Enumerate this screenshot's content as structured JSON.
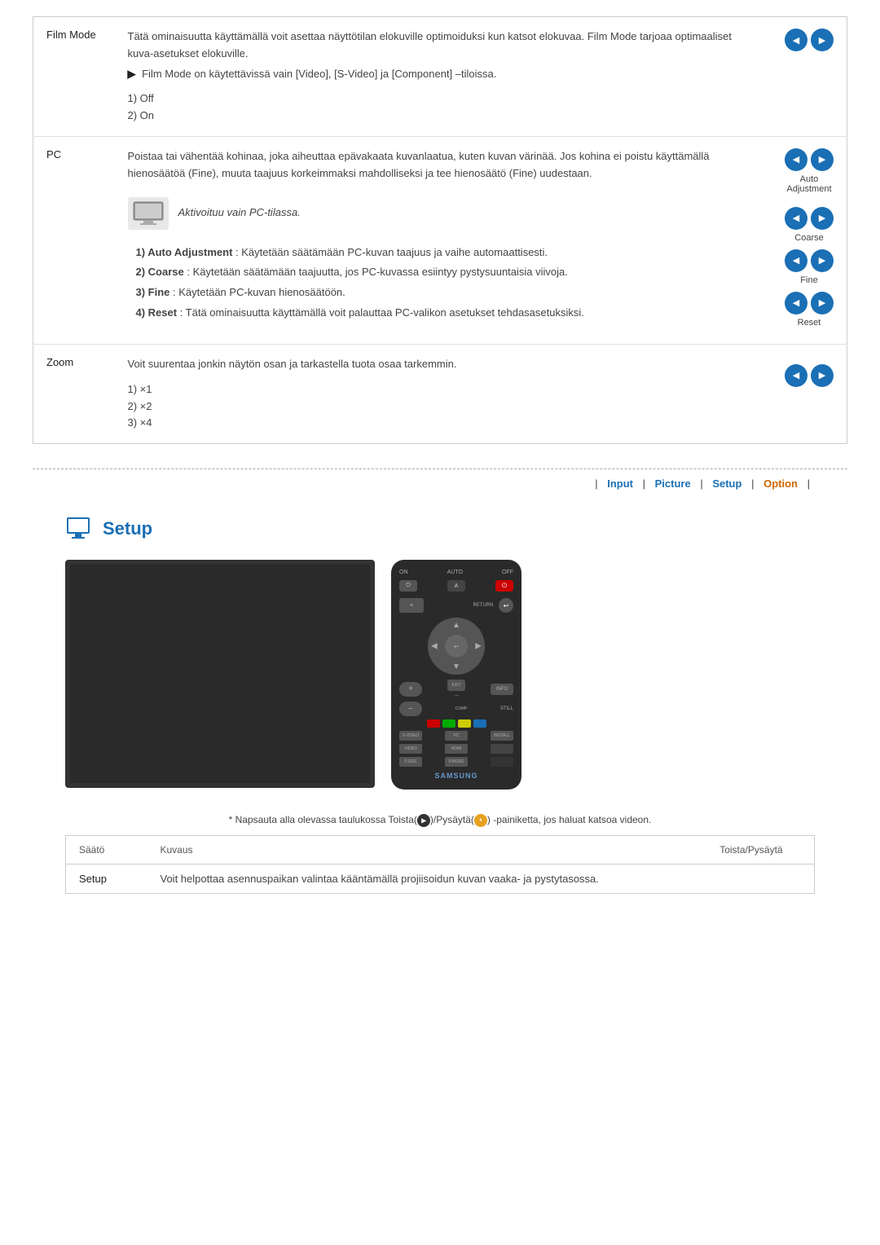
{
  "topSection": {
    "rows": [
      {
        "label": "Film Mode",
        "content_lines": [
          "Tätä ominaisuutta käyttämällä voit asettaa näyttötilan elokuville optimoiduksi kun katsot",
          "elokuvaa. Film Mode tarjoaa optimaaliset kuva-asetukset elokuville.",
          "▶ Film Mode on käytettävissä vain [Video], [S-Video] ja [Component] –tiloissa."
        ],
        "options": [
          "1) Off",
          "2) On"
        ],
        "hasButtons": true,
        "buttonPairs": 1
      },
      {
        "label": "PC",
        "content_lines": [
          "Poistaa tai vähentää kohinaa, joka aiheuttaa epävakaata kuvanlaatua, kuten kuvan",
          "värinää. Jos kohina ei poistu käyttämällä hienosäätöä (Fine), muuta taajuus",
          "korkeimmaksi mahdolliseksi ja tee hienosäätö (Fine) uudestaan."
        ],
        "pc_note": "Aktivoituu vain PC-tilassa.",
        "numbered_items": [
          {
            "prefix": "1) Auto Adjustment",
            "rest": ": Käytetään säätämään PC-kuvan taajuus ja vaihe automaattisesti."
          },
          {
            "prefix": "2) Coarse",
            "rest": ": Käytetään säätämään taajuutta, jos PC-kuvassa esiintyy pystysuuntaisia viivoja."
          },
          {
            "prefix": "3) Fine",
            "rest": ": Käytetään PC-kuvan hienosäätöön."
          },
          {
            "prefix": "4) Reset",
            "rest": ": Tätä ominaisuutta käyttämällä voit palauttaa PC-valikon asetukset tehdasasetuksiksi."
          }
        ],
        "button_groups": [
          {
            "label": "Auto\nAdjustment"
          },
          {
            "label": "Coarse"
          },
          {
            "label": "Fine"
          },
          {
            "label": "Reset"
          }
        ]
      },
      {
        "label": "Zoom",
        "content_line": "Voit suurentaa jonkin näytön osan ja tarkastella tuota osaa tarkemmin.",
        "options": [
          "1) ×1",
          "2) ×2",
          "3) ×4"
        ],
        "hasButtons": true
      }
    ]
  },
  "navbar": {
    "separator": "|",
    "items": [
      "Input",
      "Picture",
      "Setup",
      "Option"
    ],
    "active": "Option"
  },
  "setupSection": {
    "title": "Setup"
  },
  "note": {
    "text": "* Napsauta alla olevassa taulukossa Toista(▶)/Pysäytä(⏸) -painiketta, jos haluat katsoa videon."
  },
  "bottomTable": {
    "headers": [
      "Säätö",
      "Kuvaus",
      "Toista/Pysäytä"
    ],
    "rows": [
      {
        "label": "Setup",
        "description": "Voit helpottaa asennuspaikan valintaa kääntämällä projiisoidun kuvan vaaka- ja pystytasossa.",
        "action": ""
      }
    ]
  }
}
